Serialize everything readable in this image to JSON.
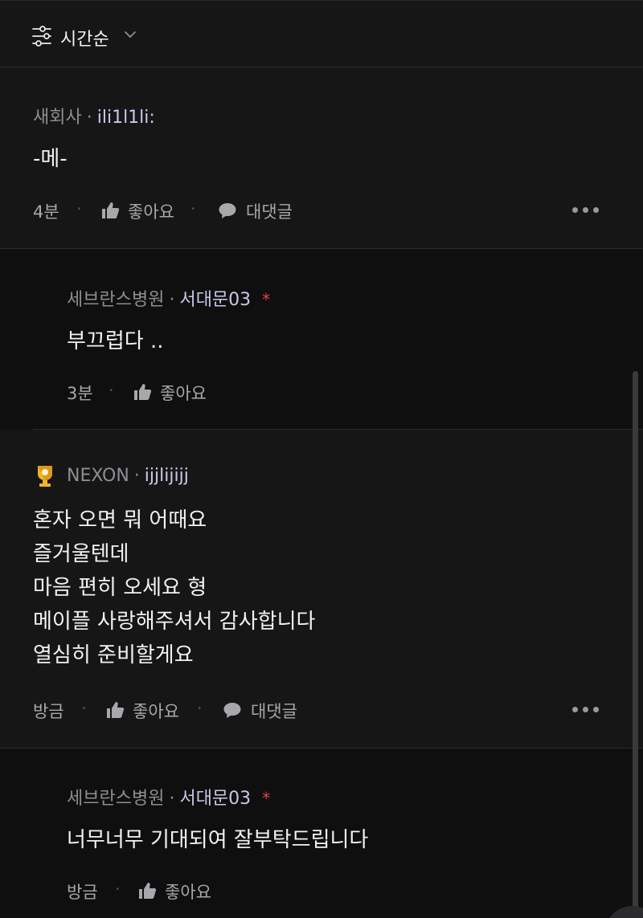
{
  "sort": {
    "label": "시간순"
  },
  "comments": [
    {
      "company": "새회사",
      "nick": "ili1l1li:",
      "text": "-메-",
      "time": "4분",
      "like_label": "좋아요",
      "reply_label": "대댓글"
    },
    {
      "company": "세브란스병원",
      "nick": "서대문03",
      "star": "*",
      "text": "부끄럽다 ..",
      "time": "3분",
      "like_label": "좋아요"
    },
    {
      "company": "NEXON",
      "nick": "ijjlijijj",
      "text": "혼자 오면 뭐 어때요\n즐거울텐데\n마음 편히 오세요 형\n메이플 사랑해주셔서 감사합니다\n열심히 준비할게요",
      "time": "방금",
      "like_label": "좋아요",
      "reply_label": "대댓글"
    },
    {
      "company": "세브란스병원",
      "nick": "서대문03",
      "star": "*",
      "text": "너무너무 기대되여 잘부탁드립니다",
      "time": "방금",
      "like_label": "좋아요"
    }
  ],
  "icons": {
    "sort": "sliders-icon",
    "chevron": "chevron-down-icon",
    "like": "thumbs-up-icon",
    "reply": "speech-bubble-icon",
    "more": "more-horizontal-icon",
    "badge": "trophy-icon"
  },
  "colors": {
    "background": "#0f0f10",
    "panel": "#161617",
    "nickname": "#c8c9e8",
    "star": "#e04343"
  }
}
